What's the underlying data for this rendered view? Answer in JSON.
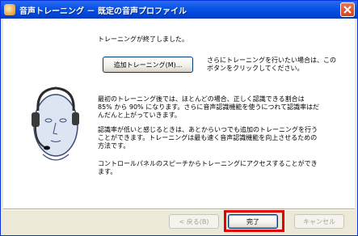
{
  "window": {
    "title": "音声トレーニング － 既定の音声プロファイル"
  },
  "content": {
    "completed_text": "トレーニングが終了しました。",
    "add_training_button": "追加トレーニング(M)...",
    "add_training_hint": "さらにトレーニングを行いたい場合は、このボタンをクリックしてください。",
    "paragraph1": "最初のトレーニング後では、ほとんどの場合、正しく認識できる割合は 85% から 90% になります。さらに音声認識機能を使うにつれて認識率はだんだんと上がっていきます。",
    "paragraph2": "認識率が低いと感じるときは、あとからいつでも追加のトレーニングを行うことができます。トレーニングは最も速く音声認識機能を向上させるための方法です。",
    "paragraph3": "コントロールパネルのスピーチからトレーニングにアクセスすることができます。"
  },
  "buttons": {
    "back": "< 戻る(B)",
    "finish": "完了",
    "cancel": "キャンセル"
  },
  "icons": {
    "app": "speech-app-icon",
    "close": "close-icon",
    "illustration": "headset-face-icon"
  }
}
